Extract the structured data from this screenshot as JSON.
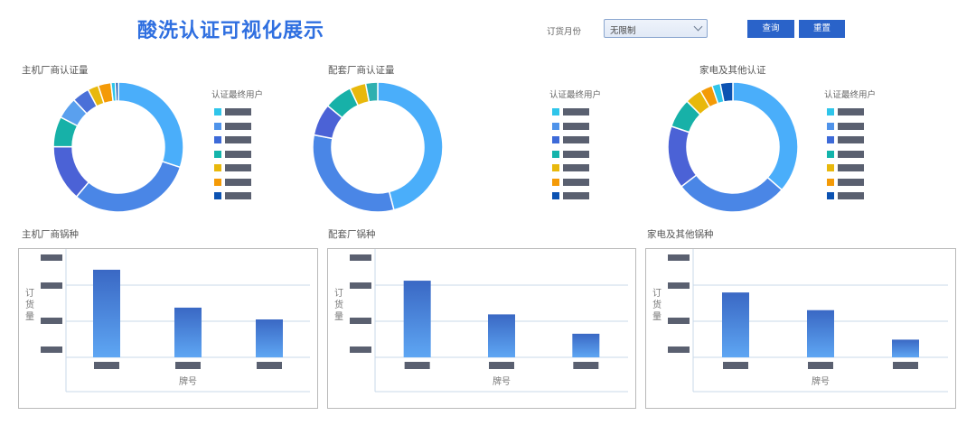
{
  "header": {
    "title": "酸洗认证可视化展示",
    "filter_label": "订货月份",
    "filter_value": "无限制",
    "query_label": "查询",
    "reset_label": "重置"
  },
  "palette": [
    "#4aaefa",
    "#4f93ea",
    "#3d6ad8",
    "#13b4ab",
    "#e8b80c",
    "#f49a07",
    "#0b52b2",
    "#2fc5ea"
  ],
  "legend_title": "认证最终用户",
  "chart_data": [
    {
      "type": "pie",
      "title": "主机厂商认证量",
      "slices": [
        28,
        29,
        13,
        7,
        5,
        4,
        2.5,
        3,
        1,
        0.7
      ]
    },
    {
      "type": "pie",
      "title": "配套厂商认证量",
      "slices": [
        46,
        32,
        8,
        7,
        4,
        3
      ]
    },
    {
      "type": "pie",
      "title": "家电及其他认证",
      "slices": [
        35,
        27,
        15,
        7,
        4,
        3,
        2,
        3
      ]
    },
    {
      "type": "bar",
      "title": "主机厂商锅种",
      "xlabel": "牌号",
      "ylabel": "订货量",
      "values": [
        104,
        59,
        45
      ],
      "ylim": [
        0,
        120
      ]
    },
    {
      "type": "bar",
      "title": "配套厂锅种",
      "xlabel": "牌号",
      "ylabel": "订货量",
      "values": [
        91,
        51,
        28
      ],
      "ylim": [
        0,
        120
      ]
    },
    {
      "type": "bar",
      "title": "家电及其他锅种",
      "xlabel": "牌号",
      "ylabel": "订货量",
      "values": [
        77,
        56,
        21
      ],
      "ylim": [
        0,
        120
      ]
    }
  ]
}
